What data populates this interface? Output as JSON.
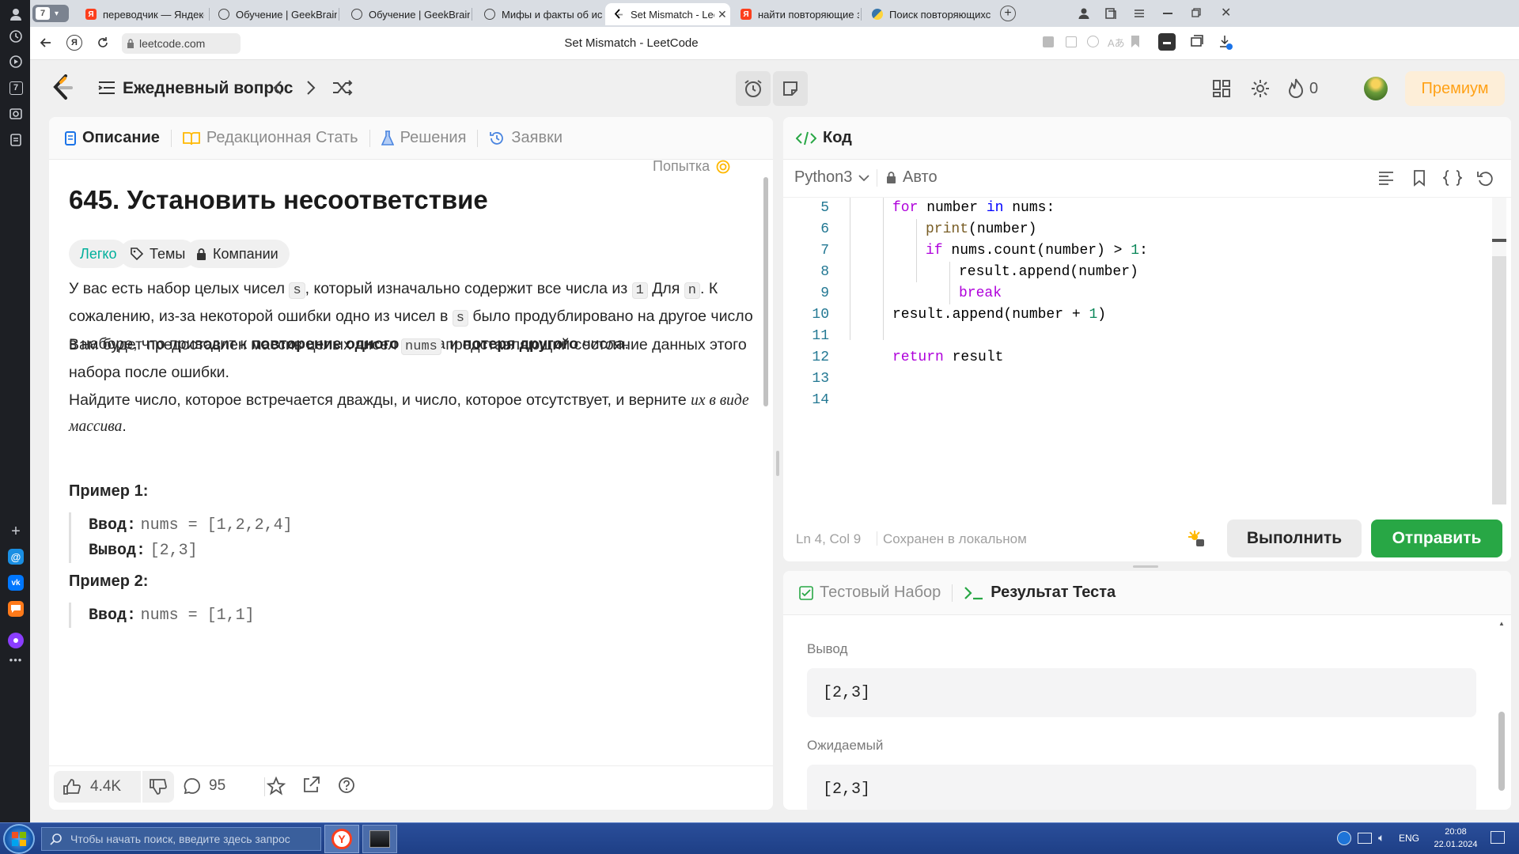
{
  "browser": {
    "tab_count": "7",
    "tabs": [
      {
        "label": "переводчик — Яндекс: на"
      },
      {
        "label": "Обучение | GeekBrains - о"
      },
      {
        "label": "Обучение | GeekBrains - о"
      },
      {
        "label": "Мифы и факты об искусс"
      },
      {
        "label": "Set Mismatch - LeetCode"
      },
      {
        "label": "найти повторяющие знач"
      },
      {
        "label": "Поиск повторяющихся зн"
      }
    ],
    "address": "leetcode.com",
    "page_title": "Set Mismatch - LeetCode"
  },
  "header": {
    "daily_question": "Ежедневный вопрос",
    "streak": "0",
    "premium": "Премиум"
  },
  "description": {
    "tabs": [
      "Описание",
      "Редакционная Стать",
      "Решения",
      "Заявки"
    ],
    "title": "645. Установить несоответствие",
    "attempt": "Попытка",
    "difficulty": "Легко",
    "topics": "Темы",
    "companies": "Компании",
    "p1": {
      "a": "У вас есть набор целых чисел ",
      "s1": "s",
      "b": ", который изначально содержит все числа из ",
      "one": "1",
      "c": " Для ",
      "n": "n",
      "d": ". К сожалению, из-за некоторой ошибки одно из чисел в ",
      "s2": "s",
      "e": " было продублировано на другое число в наборе, что приводит к ",
      "bold1": "повторение одного",
      "f": " числа и ",
      "bold2": "потеря другого",
      "g": " числа."
    },
    "p2": {
      "a": "Вам будет предоставлен массив целых чисел ",
      "nums": "nums",
      "b": " представляющий состояние данных этого набора после ошибки."
    },
    "p3": {
      "a": "Найдите число, которое встречается дважды, и число, которое отсутствует, и верните ",
      "i": "их в виде массива",
      "b": "."
    },
    "example1": {
      "title": "Пример 1:",
      "input_label": "Ввод:",
      "input": "nums = [1,2,2,4]",
      "output_label": "Вывод:",
      "output": "[2,3]"
    },
    "example2": {
      "title": "Пример 2:",
      "input_label": "Ввод:",
      "input": "nums = [1,1]"
    },
    "likes": "4.4K",
    "comments": "95"
  },
  "code": {
    "tab": "Код",
    "language": "Python3",
    "mode": "Авто",
    "lines": [
      {
        "n": "5"
      },
      {
        "n": "6"
      },
      {
        "n": "7"
      },
      {
        "n": "8"
      },
      {
        "n": "9"
      },
      {
        "n": "10"
      },
      {
        "n": "11"
      },
      {
        "n": "12"
      },
      {
        "n": "13"
      },
      {
        "n": "14"
      }
    ],
    "status_pos": "Ln 4, Col 9",
    "status_saved": "Сохранен в локальном",
    "run": "Выполнить",
    "submit": "Отправить"
  },
  "tests": {
    "tab1": "Тестовый Набор",
    "tab2": "Результат Теста",
    "output_label": "Вывод",
    "output": "[2,3]",
    "expected_label": "Ожидаемый",
    "expected": "[2,3]"
  },
  "taskbar": {
    "search_placeholder": "Чтобы начать поиск, введите здесь запрос",
    "lang": "ENG",
    "time": "20:08",
    "date": "22.01.2024"
  },
  "colors": {
    "accent_green": "#28a745",
    "premium_bg": "#fdeed8",
    "premium_text": "#ffa116"
  }
}
